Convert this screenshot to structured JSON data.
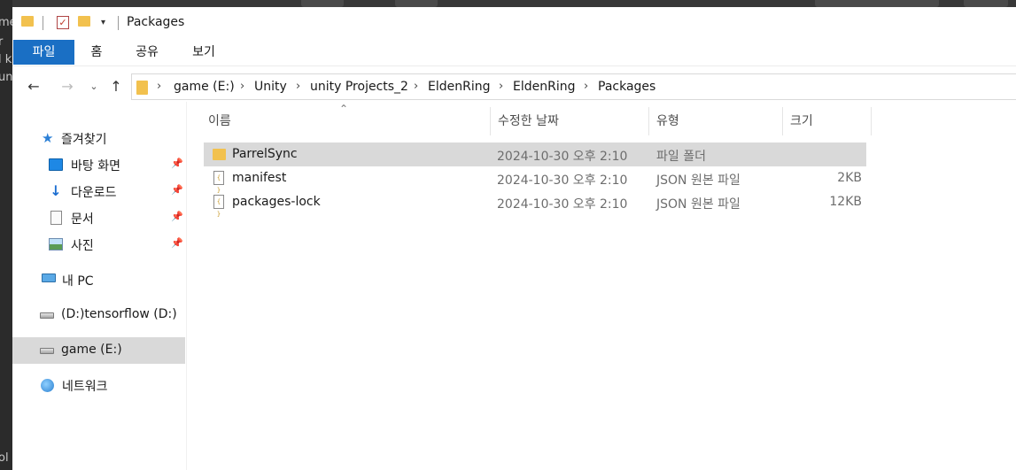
{
  "window": {
    "title": "Packages"
  },
  "background_app": {
    "left_fragments": [
      "me",
      "r",
      "l k",
      "un",
      "ol"
    ]
  },
  "ribbon": {
    "tabs": [
      "파일",
      "홈",
      "공유",
      "보기"
    ]
  },
  "address_bar": {
    "crumbs": [
      "game (E:)",
      "Unity",
      "unity Projects_2",
      "EldenRing",
      "EldenRing",
      "Packages"
    ]
  },
  "nav_pane": {
    "quick_access": "즐겨찾기",
    "pinned": [
      "바탕 화면",
      "다운로드",
      "문서",
      "사진"
    ],
    "this_pc": "내 PC",
    "drive_d": "(D:)tensorflow (D:)",
    "drive_e": "game (E:)",
    "network": "네트워크"
  },
  "columns": {
    "name": "이름",
    "modified": "수정한 날짜",
    "type": "유형",
    "size": "크기"
  },
  "files": [
    {
      "name": "ParrelSync",
      "modified": "2024-10-30 오후 2:10",
      "type": "파일 폴더",
      "size": "",
      "icon": "folder-icon",
      "selected": true
    },
    {
      "name": "manifest",
      "modified": "2024-10-30 오후 2:10",
      "type": "JSON 원본 파일",
      "size": "2KB",
      "icon": "json-file-icon",
      "selected": false
    },
    {
      "name": "packages-lock",
      "modified": "2024-10-30 오후 2:10",
      "type": "JSON 원본 파일",
      "size": "12KB",
      "icon": "json-file-icon",
      "selected": false
    }
  ],
  "colors": {
    "accent": "#1a6fc4",
    "selection": "#d9d9d9",
    "folder": "#f2c14e"
  }
}
